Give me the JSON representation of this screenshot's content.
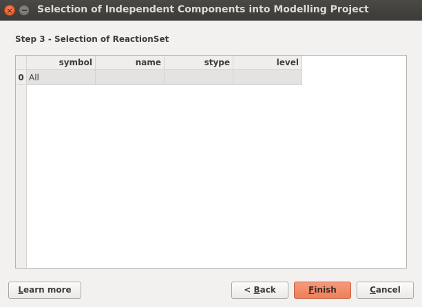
{
  "window": {
    "title": "Selection of Independent Components into Modelling Project"
  },
  "step": {
    "title": "Step 3 - Selection of ReactionSet"
  },
  "table": {
    "columns": [
      "symbol",
      "name",
      "stype",
      "level"
    ],
    "rows": [
      {
        "index": "0",
        "cells": [
          "All",
          "",
          "",
          ""
        ]
      }
    ]
  },
  "buttons": {
    "learn_more": {
      "mnemonic": "L",
      "rest": "earn more"
    },
    "back": {
      "prefix": "< ",
      "mnemonic": "B",
      "rest": "ack"
    },
    "finish": {
      "mnemonic": "F",
      "rest": "inish"
    },
    "cancel": {
      "mnemonic": "C",
      "rest": "ancel"
    }
  },
  "colors": {
    "titlebar": "#3c3b37",
    "close_button": "#e1531d",
    "primary_button": "#ee7f5a",
    "window_bg": "#f2f1f0"
  }
}
